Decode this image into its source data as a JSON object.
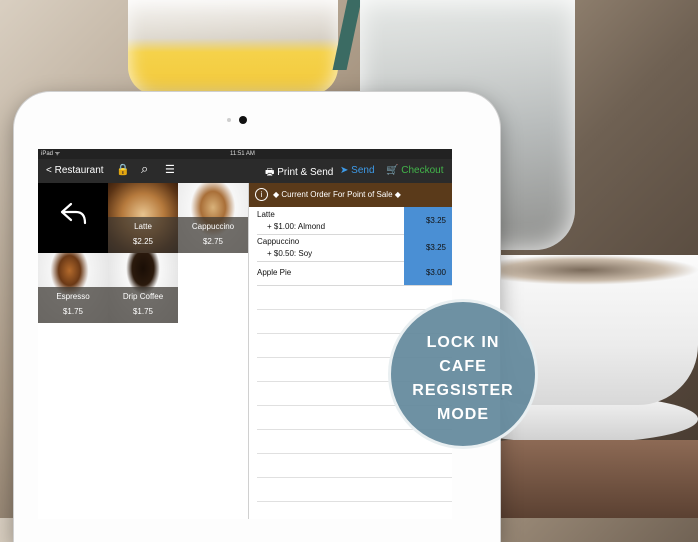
{
  "status": {
    "carrier": "iPad ᯤ",
    "time": "11:51 AM"
  },
  "navbar": {
    "back_label": "< Restaurant",
    "lock_icon": "🔒",
    "search_icon": "⌕",
    "list_icon": "☰",
    "print_send_label": "🖶 Print & Send",
    "send_label": "➤ Send",
    "checkout_label": "🛒 Checkout"
  },
  "products": [
    {
      "name": "Latte",
      "price": "$2.25"
    },
    {
      "name": "Cappuccino",
      "price": "$2.75"
    },
    {
      "name": "Espresso",
      "price": "$1.75"
    },
    {
      "name": "Drip Coffee",
      "price": "$1.75"
    }
  ],
  "order": {
    "info_icon": "i",
    "title": "◆ Current Order For Point of Sale ◆",
    "items": [
      {
        "name": "Latte",
        "modifier": "+ $1.00: Almond",
        "price": "$3.25"
      },
      {
        "name": "Cappuccino",
        "modifier": "+ $0.50: Soy",
        "price": "$3.25"
      },
      {
        "name": "Apple Pie",
        "modifier": "",
        "price": "$3.00"
      }
    ]
  },
  "badge": {
    "lines": [
      "LOCK IN",
      "CAFE",
      "REGSISTER",
      "MODE"
    ]
  },
  "colors": {
    "order_header": "#5a3a1a",
    "price_cell": "#4a8fd4",
    "send": "#3d9ae8",
    "checkout": "#42b54a",
    "badge": "#62889b"
  }
}
